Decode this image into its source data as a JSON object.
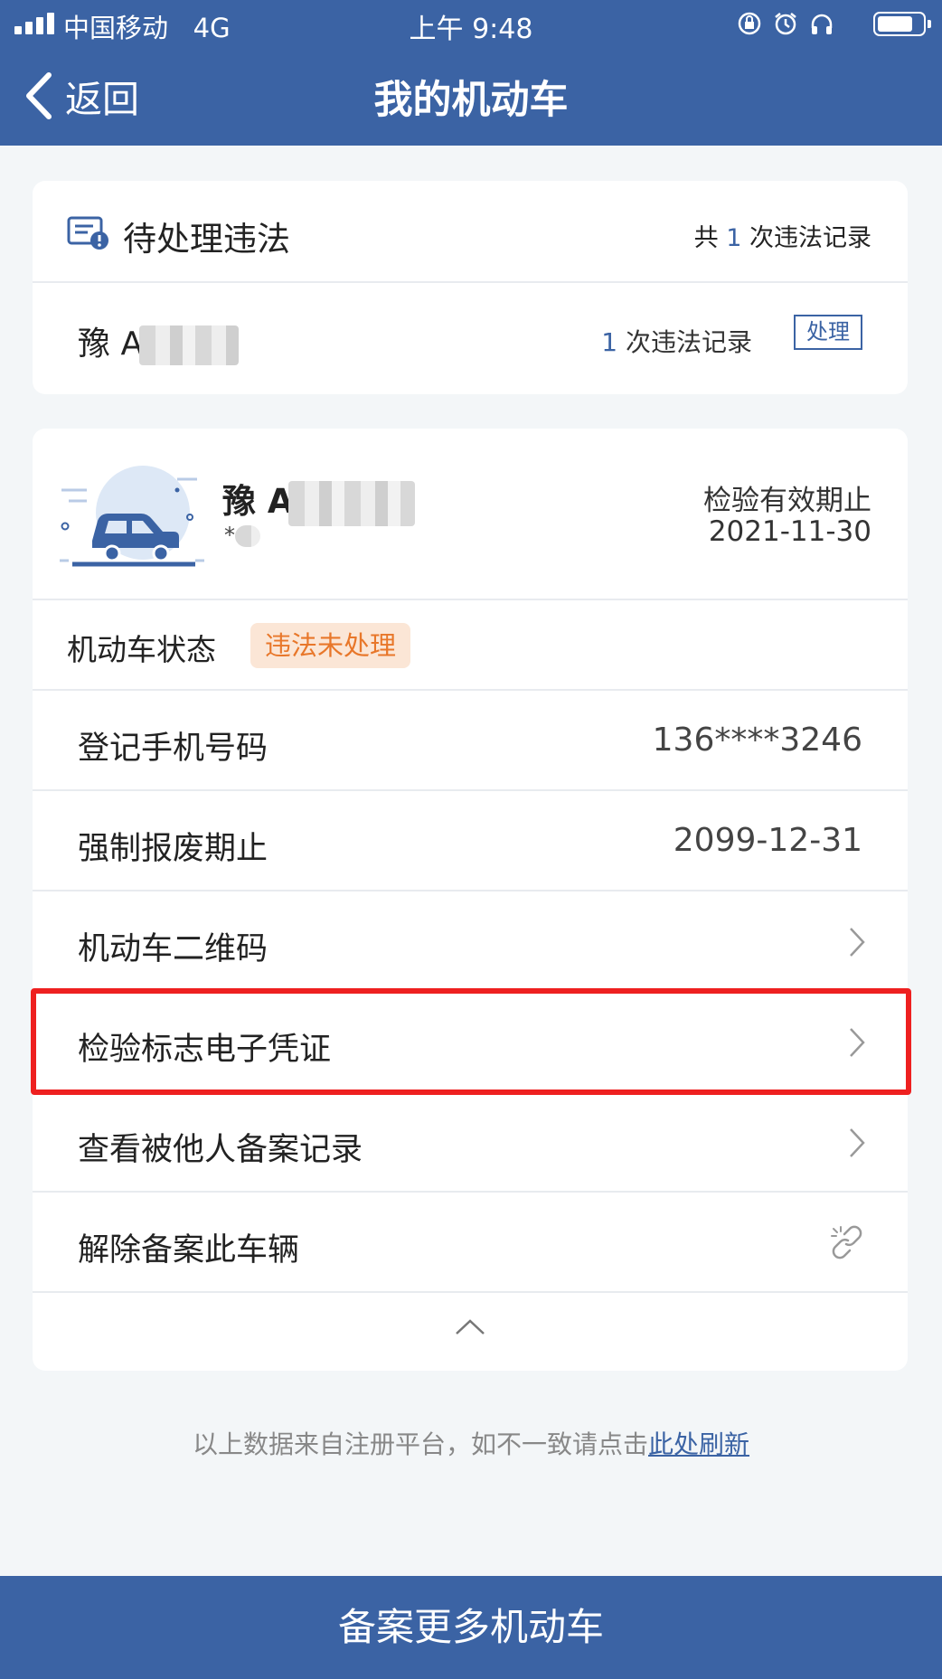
{
  "status_bar": {
    "carrier": "中国移动",
    "network": "4G",
    "time": "上午 9:48"
  },
  "nav": {
    "back_label": "返回",
    "title": "我的机动车"
  },
  "violations": {
    "title": "待处理违法",
    "total_prefix": "共 ",
    "total_count": "1",
    "total_suffix": " 次违法记录",
    "vehicle_plate": "豫 A",
    "vehicle_count": "1",
    "vehicle_count_suffix": " 次违法记录",
    "handle_label": "处理"
  },
  "vehicle": {
    "plate": "豫 A",
    "sub": "*",
    "inspection_label": "检验有效期止",
    "inspection_date": "2021-11-30",
    "status_label": "机动车状态",
    "status_badge": "违法未处理",
    "rows": [
      {
        "label": "登记手机号码",
        "value": "136****3246"
      },
      {
        "label": "强制报废期止",
        "value": "2099-12-31"
      },
      {
        "label": "机动车二维码"
      },
      {
        "label": "检验标志电子凭证"
      },
      {
        "label": "查看被他人备案记录"
      },
      {
        "label": "解除备案此车辆"
      }
    ]
  },
  "footnote": {
    "text": "以上数据来自注册平台，如不一致请点击",
    "link": "此处刷新"
  },
  "bottom_button": "备案更多机动车",
  "colors": {
    "brand_blue": "#3b63a4",
    "badge_bg": "#fbe6d6",
    "badge_text": "#e8772a",
    "highlight_red": "#ee2020"
  }
}
